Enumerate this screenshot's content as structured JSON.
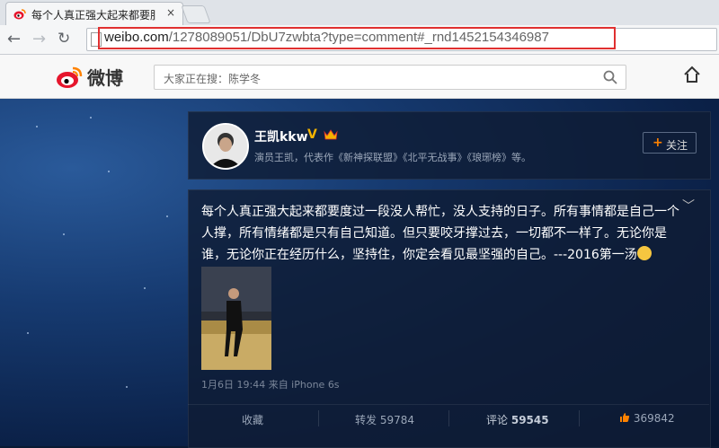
{
  "browser": {
    "tab_title": "每个人真正强大起来都要服",
    "tab_close": "×",
    "url_host": "weibo.com",
    "url_path": "/1278089051/DbU7zwbta?type=comment#_rnd1452154346987"
  },
  "weibo": {
    "logo_text": "微博",
    "search_placeholder": "大家正在搜：陈学冬"
  },
  "profile": {
    "name": "王凯kkw",
    "verified": "V",
    "intro": "演员王凯，代表作《新神探联盟》《北平无战事》《琅琊榜》等。",
    "follow_label": "关注",
    "follow_plus": "+"
  },
  "post": {
    "expand_icon": "﹀",
    "text": "每个人真正强大起来都要度过一段没人帮忙，没人支持的日子。所有事情都是自己一个人撑，所有情绪都是只有自己知道。但只要咬牙撑过去，一切都不一样了。无论你是谁，无论你正在经历什么，坚持住，你定会看见最坚强的自己。---2016第一汤",
    "meta": "1月6日 19:44 来自 iPhone 6s",
    "actions": {
      "collect": "收藏",
      "repost": "转发 59784",
      "comment_label": "评论",
      "comment_count": "59545",
      "like_count": "369842"
    }
  },
  "colors": {
    "accent_orange": "#ff8200",
    "highlight_red": "#e03030",
    "verified_gold": "#f4b400"
  }
}
